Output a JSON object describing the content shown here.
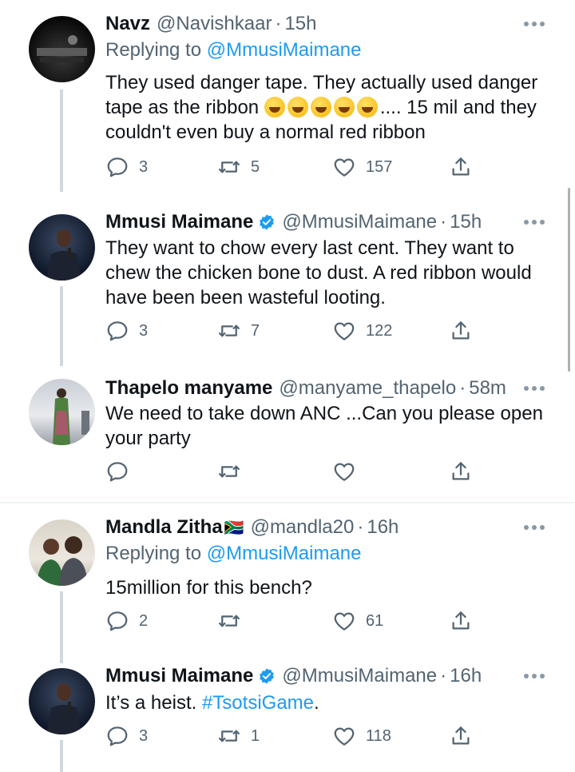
{
  "tweets": [
    {
      "name": "Navz",
      "handle": "@Navishkaar",
      "dot": "·",
      "time": "15h",
      "verified": false,
      "replying_prefix": "Replying to ",
      "replying_handle": "@MmusiMaimane",
      "text_part1": "They used danger tape. They actually used danger tape as the ribbon ",
      "emoji_count": 5,
      "text_part2": ".... 15 mil and they couldn't even buy a normal red ribbon",
      "replies": "3",
      "retweets": "5",
      "likes": "157"
    },
    {
      "name": "Mmusi Maimane",
      "handle": "@MmusiMaimane",
      "dot": "·",
      "time": "15h",
      "verified": true,
      "text": "They want to chow every last cent. They want to chew the chicken bone to dust. A red ribbon would have been been wasteful looting.",
      "replies": "3",
      "retweets": "7",
      "likes": "122"
    },
    {
      "name": "Thapelo manyame",
      "handle": "@manyame_thapelo",
      "dot": "·",
      "time": "58m",
      "verified": false,
      "text": "We need to take down ANC ...Can you please open your party",
      "replies": "",
      "retweets": "",
      "likes": ""
    },
    {
      "name": "Mandla Zitha",
      "flag_emoji": "🇿🇦",
      "handle": "@mandla20",
      "dot": "·",
      "time": "16h",
      "verified": false,
      "replying_prefix": "Replying to ",
      "replying_handle": "@MmusiMaimane",
      "text": "15million for this bench?",
      "replies": "2",
      "retweets": "",
      "likes": "61"
    },
    {
      "name": "Mmusi Maimane",
      "handle": "@MmusiMaimane",
      "dot": "·",
      "time": "16h",
      "verified": true,
      "text_plain": "It’s a heist. ",
      "hashtag": "#TsotsiGame",
      "text_end": ".",
      "replies": "3",
      "retweets": "1",
      "likes": "118"
    }
  ],
  "colors": {
    "text": "#0f1419",
    "secondary": "#536471",
    "link": "#1d9bf0",
    "thread_line": "#cfd9de",
    "verified_badge": "#1d9bf0"
  },
  "icons": [
    "reply-icon",
    "retweet-icon",
    "like-icon",
    "share-icon",
    "more-icon",
    "verified-badge-icon"
  ]
}
